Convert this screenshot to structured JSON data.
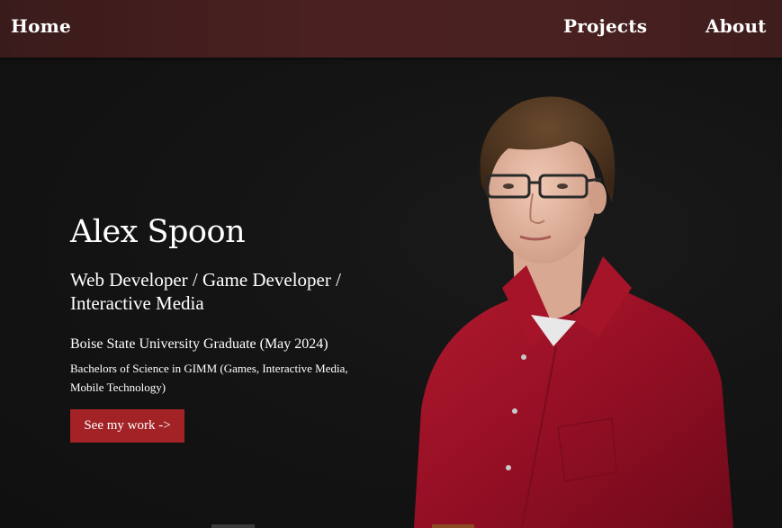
{
  "nav": {
    "home": "Home",
    "projects": "Projects",
    "about": "About"
  },
  "hero": {
    "name": "Alex Spoon",
    "role": "Web Developer / Game Developer / Interactive Media",
    "school": "Boise State University Graduate (May 2024)",
    "degree": "Bachelors of Science in GIMM (Games, Interactive Media, Mobile Technology)",
    "cta": "See my work ->"
  },
  "colors": {
    "navbar": "#4a2020",
    "background": "#121212",
    "button": "#a32226",
    "shirt": "#9a1426"
  },
  "portrait": {
    "description_icon": "person-photo"
  }
}
